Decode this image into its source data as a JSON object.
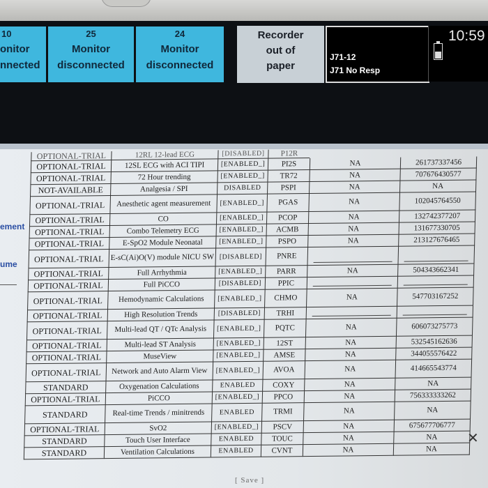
{
  "monitor_strip": {
    "tiles": [
      {
        "num": "10",
        "line1": "onitor",
        "line2": "nnected"
      },
      {
        "num": "25",
        "line1": "Monitor",
        "line2": "disconnected"
      },
      {
        "num": "24",
        "line1": "Monitor",
        "line2": "disconnected"
      }
    ],
    "recorder": {
      "line1": "Recorder",
      "line2": "out of",
      "line3": "paper"
    },
    "message": {
      "line1": "J71-12",
      "line2": "J71 No Resp"
    },
    "clock": "10:59"
  },
  "sidebar": {
    "item1": "ement",
    "item2": "ume"
  },
  "options_table": {
    "top_cut_row": [
      "OPTIONAL-TRIAL",
      "12RL 12-lead ECG",
      "[DISABLED]",
      "P12R"
    ],
    "rows": [
      {
        "cat": "OPTIONAL-TRIAL",
        "desc": "12SL ECG with ACI TIPI",
        "status": "[ENABLED_]",
        "code": "PI2S",
        "na": "NA",
        "key": "261737337456"
      },
      {
        "cat": "OPTIONAL-TRIAL",
        "desc": "72 Hour trending",
        "status": "[ENABLED_]",
        "code": "TR72",
        "na": "NA",
        "key": "707676430577"
      },
      {
        "cat": "NOT-AVAILABLE",
        "desc": "Analgesia / SPI",
        "status": "DISABLED",
        "code": "PSPI",
        "na": "NA",
        "key": "NA"
      },
      {
        "cat": "OPTIONAL-TRIAL",
        "desc": "Anesthetic agent measurement",
        "status": "[ENABLED_]",
        "code": "PGAS",
        "na": "NA",
        "key": "102045764550"
      },
      {
        "cat": "OPTIONAL-TRIAL",
        "desc": "CO",
        "status": "[ENABLED_]",
        "code": "PCOP",
        "na": "NA",
        "key": "132742377207"
      },
      {
        "cat": "OPTIONAL-TRIAL",
        "desc": "Combo Telemetry ECG",
        "status": "[ENABLED_]",
        "code": "ACMB",
        "na": "NA",
        "key": "131677330705"
      },
      {
        "cat": "OPTIONAL-TRIAL",
        "desc": "E-SpO2 Module Neonatal",
        "status": "[ENABLED_]",
        "code": "PSPO",
        "na": "NA",
        "key": "213127676465"
      },
      {
        "cat": "OPTIONAL-TRIAL",
        "desc": "E-sC(Ai)O(V) module NICU SW",
        "status": "[DISABLED]",
        "code": "PNRE",
        "na": "",
        "key": ""
      },
      {
        "cat": "OPTIONAL-TRIAL",
        "desc": "Full Arrhythmia",
        "status": "[ENABLED_]",
        "code": "PARR",
        "na": "NA",
        "key": "504343662341"
      },
      {
        "cat": "OPTIONAL-TRIAL",
        "desc": "Full PiCCO",
        "status": "[DISABLED]",
        "code": "PPIC",
        "na": "",
        "key": ""
      },
      {
        "cat": "OPTIONAL-TRIAL",
        "desc": "Hemodynamic Calculations",
        "status": "[ENABLED_]",
        "code": "CHMO",
        "na": "NA",
        "key": "547703167252"
      },
      {
        "cat": "OPTIONAL-TRIAL",
        "desc": "High Resolution Trends",
        "status": "[DISABLED]",
        "code": "TRHI",
        "na": "",
        "key": ""
      },
      {
        "cat": "OPTIONAL-TRIAL",
        "desc": "Multi-lead QT / QTc Analysis",
        "status": "[ENABLED_]",
        "code": "PQTC",
        "na": "NA",
        "key": "606073275773"
      },
      {
        "cat": "OPTIONAL-TRIAL",
        "desc": "Multi-lead ST Analysis",
        "status": "[ENABLED_]",
        "code": "12ST",
        "na": "NA",
        "key": "532545162636"
      },
      {
        "cat": "OPTIONAL-TRIAL",
        "desc": "MuseView",
        "status": "[ENABLED_]",
        "code": "AMSE",
        "na": "NA",
        "key": "344055576422"
      },
      {
        "cat": "OPTIONAL-TRIAL",
        "desc": "Network and Auto Alarm View",
        "status": "[ENABLED_]",
        "code": "AVOA",
        "na": "NA",
        "key": "414665543774"
      },
      {
        "cat": "STANDARD",
        "desc": "Oxygenation Calculations",
        "status": "ENABLED",
        "code": "COXY",
        "na": "NA",
        "key": "NA"
      },
      {
        "cat": "OPTIONAL-TRIAL",
        "desc": "PiCCO",
        "status": "[ENABLED_]",
        "code": "PPCO",
        "na": "NA",
        "key": "756333333262"
      },
      {
        "cat": "STANDARD",
        "desc": "Real-time Trends / minitrends",
        "status": "ENABLED",
        "code": "TRMI",
        "na": "NA",
        "key": "NA"
      },
      {
        "cat": "OPTIONAL-TRIAL",
        "desc": "SvO2",
        "status": "[ENABLED_]",
        "code": "PSCV",
        "na": "NA",
        "key": "675677706777"
      },
      {
        "cat": "STANDARD",
        "desc": "Touch User Interface",
        "status": "ENABLED",
        "code": "TOUC",
        "na": "NA",
        "key": "NA"
      },
      {
        "cat": "STANDARD",
        "desc": "Ventilation Calculations",
        "status": "ENABLED",
        "code": "CVNT",
        "na": "NA",
        "key": "NA"
      }
    ]
  },
  "footer": {
    "save": "[ Save ]"
  },
  "colors": {
    "tile_blue": "#3fb7de",
    "panel_bg": "#e6eaee",
    "grid_line": "#333333"
  }
}
